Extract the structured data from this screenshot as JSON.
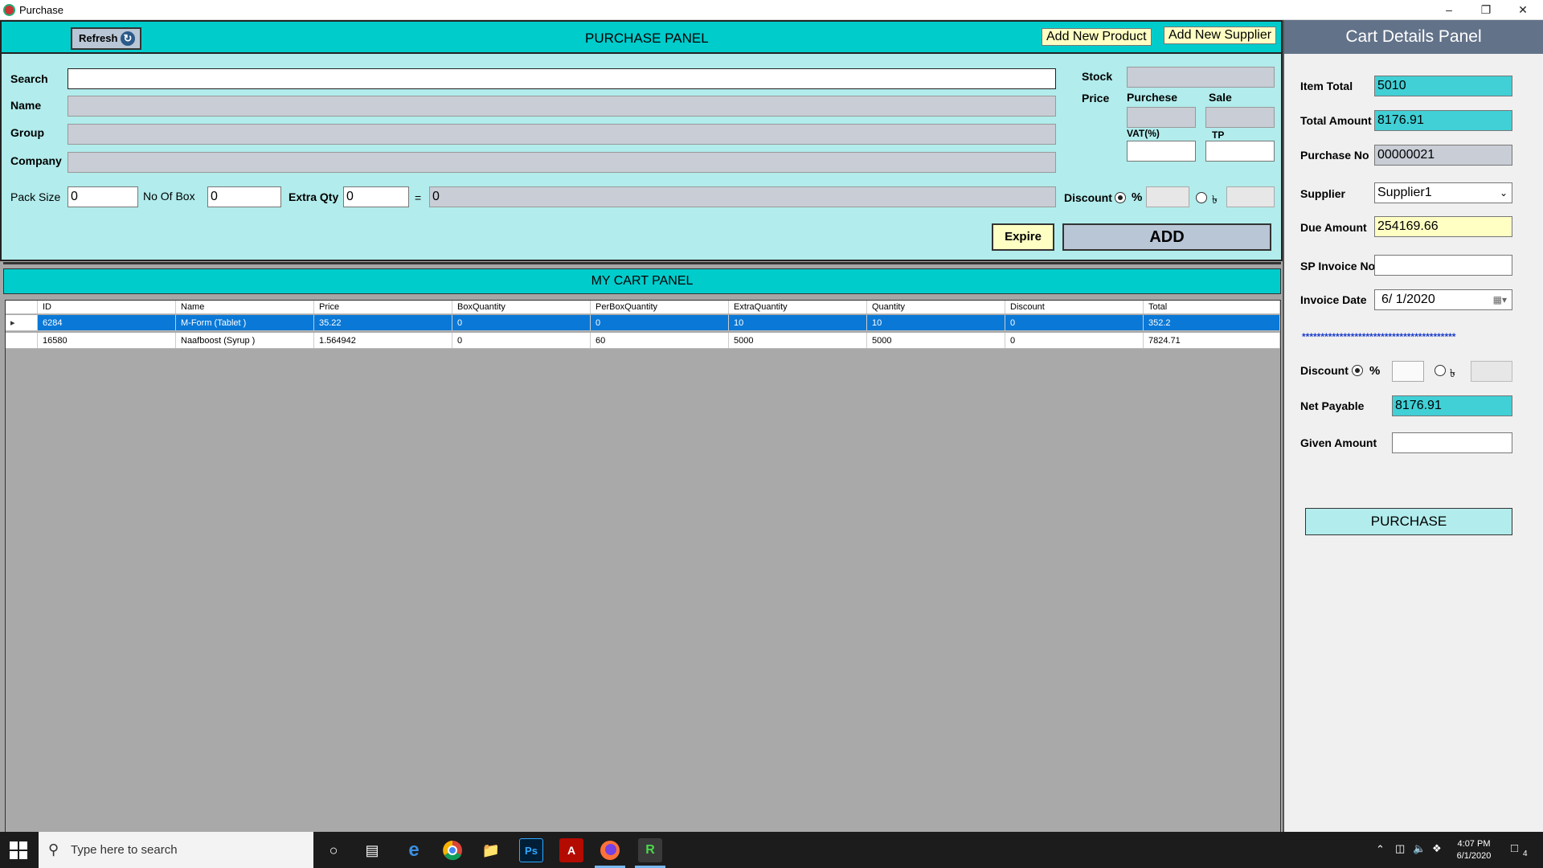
{
  "window": {
    "title": "Purchase"
  },
  "purchase_panel": {
    "refresh_label": "Refresh",
    "title": "PURCHASE PANEL",
    "add_new_product_label": "Add New Product",
    "add_new_supplier_label": "Add New Supplier",
    "labels": {
      "search": "Search",
      "name": "Name",
      "group": "Group",
      "company": "Company",
      "stock": "Stock",
      "price": "Price",
      "purchese": "Purchese",
      "sale": "Sale",
      "vat": "VAT(%)",
      "tp": "TP",
      "pack_size": "Pack Size",
      "no_of_box": "No Of Box",
      "extra_qty": "Extra Qty",
      "equals": "=",
      "discount": "Discount",
      "percent": "%",
      "taka": "৳"
    },
    "values": {
      "pack_size": "0",
      "no_of_box": "0",
      "extra_qty": "0",
      "total_qty": "0"
    },
    "expire_label": "Expire",
    "add_label": "ADD"
  },
  "cart_panel": {
    "title": "MY CART PANEL",
    "columns": [
      "ID",
      "Name",
      "Price",
      "BoxQuantity",
      "PerBoxQuantity",
      "ExtraQuantity",
      "Quantity",
      "Discount",
      "Total"
    ],
    "rows": [
      [
        "6284",
        "M-Form (Tablet )",
        "35.22",
        "0",
        "0",
        "10",
        "10",
        "0",
        "352.2"
      ],
      [
        "16580",
        "Naafboost (Syrup )",
        "1.564942",
        "0",
        "60",
        "5000",
        "5000",
        "0",
        "7824.71"
      ]
    ]
  },
  "cart_details": {
    "title": "Cart Details Panel",
    "item_total_label": "Item Total",
    "item_total": "5010",
    "total_amount_label": "Total Amount",
    "total_amount": "8176.91",
    "purchase_no_label": "Purchase No",
    "purchase_no": "00000021",
    "supplier_label": "Supplier",
    "supplier": "Supplier1",
    "due_amount_label": "Due Amount",
    "due_amount": "254169.66",
    "sp_invoice_label": "SP Invoice No",
    "sp_invoice": "",
    "invoice_date_label": "Invoice Date",
    "invoice_date": "6/  1/2020",
    "separator": "*****************************************",
    "discount_label": "Discount",
    "percent": "%",
    "taka": "৳",
    "net_payable_label": "Net Payable",
    "net_payable": "8176.91",
    "given_amount_label": "Given Amount",
    "given_amount": "",
    "purchase_button": "PURCHASE"
  },
  "taskbar": {
    "search_placeholder": "Type here to search",
    "time": "4:07 PM",
    "date": "6/1/2020",
    "notification_count": "4"
  },
  "colors": {
    "accent": "#00cccc",
    "panel": "#b2ecec",
    "header_right": "#627289",
    "selected_row": "#0a78d7"
  }
}
